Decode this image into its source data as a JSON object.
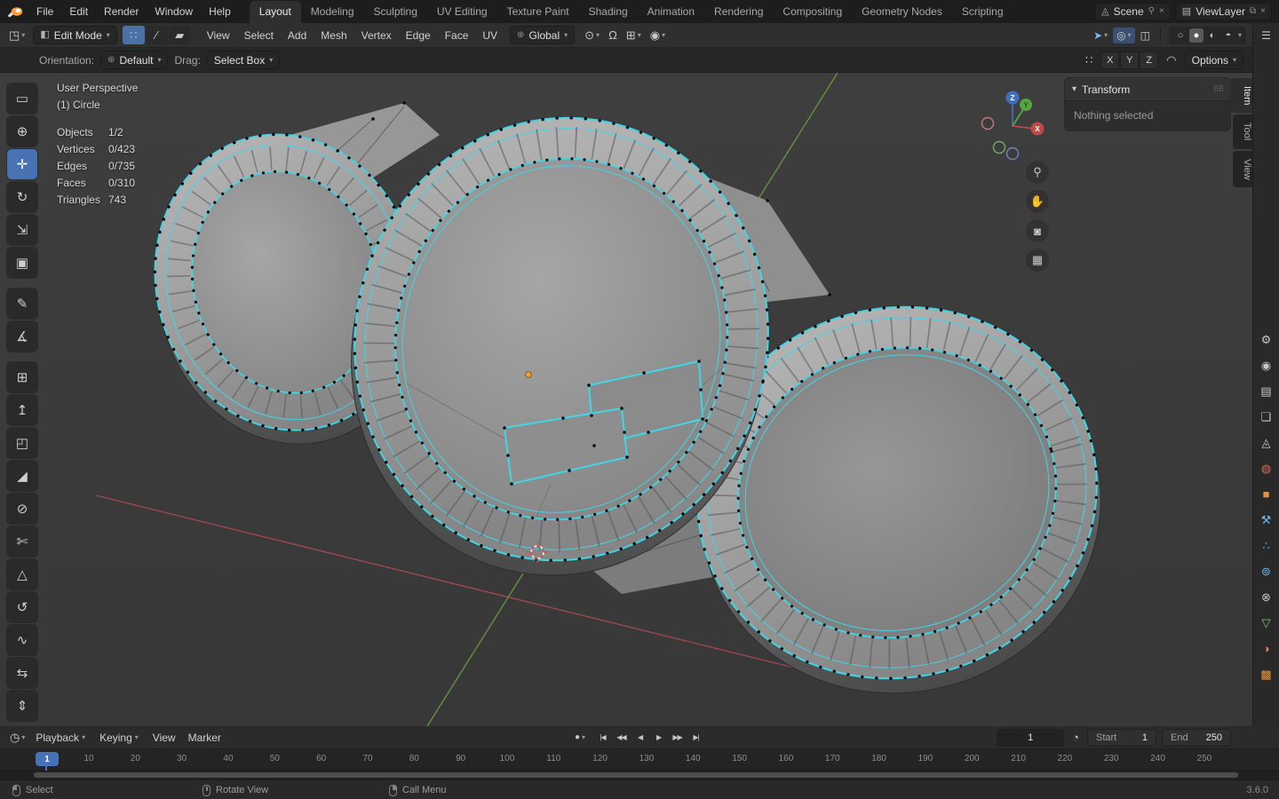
{
  "colors": {
    "accent": "#4772b3",
    "edge_select": "#3fd6e6",
    "axis_x": "#a84a52",
    "axis_y": "#699c3c",
    "origin": "#ffa02f"
  },
  "icons": {
    "caret": "▾",
    "editor_viewport": "◳",
    "editor_timeline": "◷",
    "mode_cube": "◧",
    "orient": "⊕",
    "pivot": "⊙",
    "snap_magnet": "Ω",
    "snap_target": "⊞",
    "proportional": "◉",
    "mirror": "∷",
    "falloff": "◠",
    "grip": "⠿⠿",
    "record": "●",
    "clock": "◔",
    "scene": "◬",
    "viewlayer": "▤",
    "unlink": "⚲",
    "copy": "⧉",
    "close": "×",
    "properties": "☰"
  },
  "topbar": {
    "menus": [
      "File",
      "Edit",
      "Render",
      "Window",
      "Help"
    ],
    "workspaces": [
      {
        "label": "Layout",
        "active": true
      },
      {
        "label": "Modeling"
      },
      {
        "label": "Sculpting"
      },
      {
        "label": "UV Editing"
      },
      {
        "label": "Texture Paint"
      },
      {
        "label": "Shading"
      },
      {
        "label": "Animation"
      },
      {
        "label": "Rendering"
      },
      {
        "label": "Compositing"
      },
      {
        "label": "Geometry Nodes"
      },
      {
        "label": "Scripting"
      }
    ],
    "scene_label": "Scene",
    "viewlayer_label": "ViewLayer"
  },
  "header": {
    "mode": "Edit Mode",
    "select_modes": [
      {
        "name": "vertex-select-mode",
        "glyph": "∷",
        "active": true
      },
      {
        "name": "edge-select-mode",
        "glyph": "∕"
      },
      {
        "name": "face-select-mode",
        "glyph": "▰"
      }
    ],
    "menus": [
      "View",
      "Select",
      "Add",
      "Mesh",
      "Vertex",
      "Edge",
      "Face",
      "UV"
    ],
    "orientation": "Global",
    "view_toggles": [
      {
        "name": "show-gizmos-toggle",
        "glyph": "➤",
        "caret": true,
        "color": "#7ab8e8"
      },
      {
        "name": "show-overlays-toggle",
        "glyph": "◎",
        "caret": true,
        "active": true
      },
      {
        "name": "xray-toggle",
        "glyph": "◫"
      }
    ],
    "shading_modes": [
      {
        "name": "shading-wireframe",
        "glyph": "○"
      },
      {
        "name": "shading-solid",
        "glyph": "●",
        "active": true
      },
      {
        "name": "shading-material",
        "glyph": "◐"
      },
      {
        "name": "shading-rendered",
        "glyph": "◓"
      }
    ]
  },
  "subheader": {
    "orientation_label": "Orientation:",
    "orientation_value": "Default",
    "drag_label": "Drag:",
    "drag_value": "Select Box",
    "mirror_axes": [
      "X",
      "Y",
      "Z"
    ],
    "options_label": "Options"
  },
  "tools": [
    {
      "name": "tool-select-box",
      "glyph": "▭"
    },
    {
      "name": "tool-cursor",
      "glyph": "⊕"
    },
    {
      "name": "tool-move",
      "glyph": "✛",
      "active": true
    },
    {
      "name": "tool-rotate",
      "glyph": "↻"
    },
    {
      "name": "tool-scale",
      "glyph": "⇲"
    },
    {
      "name": "tool-transform",
      "glyph": "▣"
    },
    {
      "name": "tool-annotate",
      "glyph": "✎"
    },
    {
      "name": "tool-measure",
      "glyph": "∡"
    },
    {
      "name": "tool-add-cube",
      "glyph": "⊞"
    },
    {
      "name": "tool-extrude-region",
      "glyph": "↥"
    },
    {
      "name": "tool-inset-faces",
      "glyph": "◰"
    },
    {
      "name": "tool-bevel",
      "glyph": "◢"
    },
    {
      "name": "tool-loop-cut",
      "glyph": "⊘"
    },
    {
      "name": "tool-knife",
      "glyph": "✄"
    },
    {
      "name": "tool-poly-build",
      "glyph": "△"
    },
    {
      "name": "tool-spin",
      "glyph": "↺"
    },
    {
      "name": "tool-smooth",
      "glyph": "∿"
    },
    {
      "name": "tool-edge-slide",
      "glyph": "⇆"
    },
    {
      "name": "tool-shrink-fatten",
      "glyph": "⇕"
    }
  ],
  "viewport": {
    "perspective": "User Perspective",
    "object": "(1) Circle",
    "stats": [
      {
        "label": "Objects",
        "value": "1/2"
      },
      {
        "label": "Vertices",
        "value": "0/423"
      },
      {
        "label": "Edges",
        "value": "0/735"
      },
      {
        "label": "Faces",
        "value": "0/310"
      },
      {
        "label": "Triangles",
        "value": "743"
      }
    ],
    "view_buttons": [
      {
        "name": "zoom-button",
        "glyph": "⚲"
      },
      {
        "name": "pan-button",
        "glyph": "✋"
      },
      {
        "name": "camera-view-button",
        "glyph": "◙"
      },
      {
        "name": "orthographic-toggle-button",
        "glyph": "▦"
      }
    ],
    "gizmo": {
      "x": "X",
      "y": "Y",
      "z": "Z"
    }
  },
  "npanel": {
    "header": "Transform",
    "empty": "Nothing selected",
    "tabs": [
      {
        "label": "Item",
        "active": true
      },
      {
        "label": "Tool"
      },
      {
        "label": "View"
      }
    ]
  },
  "rail": [
    {
      "name": "tab-tool",
      "glyph": "⚙",
      "color": "#c8c8c8"
    },
    {
      "name": "tab-render",
      "glyph": "◉",
      "color": "#c8c8c8"
    },
    {
      "name": "tab-output",
      "glyph": "▤",
      "color": "#c8c8c8"
    },
    {
      "name": "tab-view-layer",
      "glyph": "❏",
      "color": "#c8c8c8"
    },
    {
      "name": "tab-scene",
      "glyph": "◬",
      "color": "#c8c8c8"
    },
    {
      "name": "tab-world",
      "glyph": "◍",
      "color": "#d96a5a"
    },
    {
      "name": "tab-object",
      "glyph": "■",
      "color": "#e8913c"
    },
    {
      "name": "tab-modifiers",
      "glyph": "⚒",
      "color": "#6fb7e8"
    },
    {
      "name": "tab-particles",
      "glyph": "∴",
      "color": "#6fb7e8"
    },
    {
      "name": "tab-physics",
      "glyph": "⊚",
      "color": "#6fb7e8"
    },
    {
      "name": "tab-constraints",
      "glyph": "⊗",
      "color": "#c8c8c8"
    },
    {
      "name": "tab-object-data",
      "glyph": "▽",
      "color": "#7ec77e"
    },
    {
      "name": "tab-material",
      "glyph": "◑",
      "color": "#e87a6a"
    },
    {
      "name": "tab-texture",
      "glyph": "▩",
      "color": "#e8913c"
    }
  ],
  "timeline": {
    "playback": "Playback",
    "keying": "Keying",
    "menus": [
      "View",
      "Marker"
    ],
    "transport": [
      {
        "name": "jump-to-start-button",
        "glyph": "|◀"
      },
      {
        "name": "prev-keyframe-button",
        "glyph": "◀◀"
      },
      {
        "name": "play-reverse-button",
        "glyph": "◀"
      },
      {
        "name": "play-button",
        "glyph": "▶"
      },
      {
        "name": "next-keyframe-button",
        "glyph": "▶▶"
      },
      {
        "name": "jump-to-end-button",
        "glyph": "▶|"
      }
    ],
    "current_frame": "1",
    "frame_field": "1",
    "start_label": "Start",
    "start_value": "1",
    "end_label": "End",
    "end_value": "250",
    "ticks": [
      "10",
      "20",
      "30",
      "40",
      "50",
      "60",
      "70",
      "80",
      "90",
      "100",
      "110",
      "120",
      "130",
      "140",
      "150",
      "160",
      "170",
      "180",
      "190",
      "200",
      "210",
      "220",
      "230",
      "240",
      "250"
    ]
  },
  "statusbar": {
    "select": "Select",
    "rotate": "Rotate View",
    "call_menu": "Call Menu",
    "version": "3.6.0"
  }
}
